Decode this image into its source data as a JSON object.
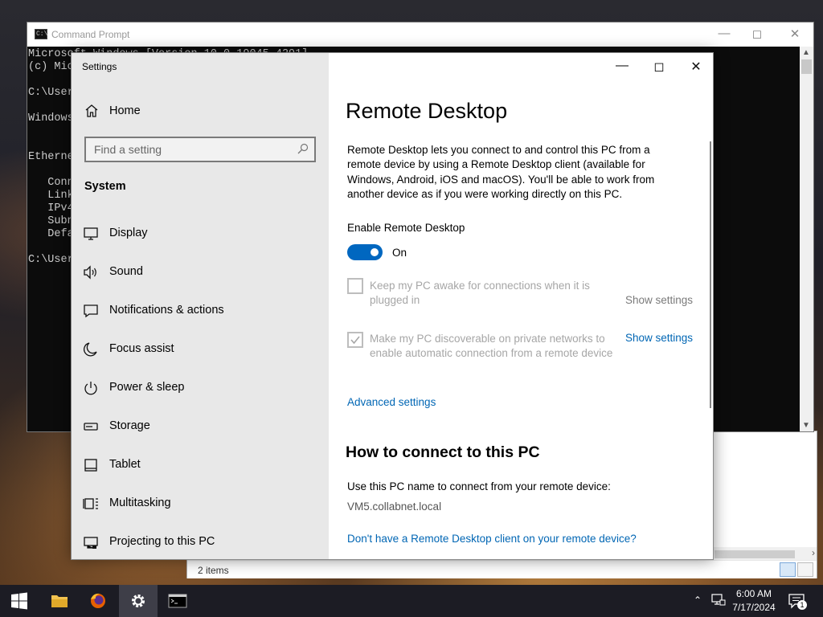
{
  "cmd": {
    "title": "Command Prompt",
    "lines": "Microsoft Windows [Version 10.0.19045.4291]\n(c) Microsoft Corporation. All rights reserved.\n\nC:\\Users\n\nWindows\n\n\nEthernet\n\n   Conn\n   Link\n   IPv4\n   Subn\n   Defa\n\nC:\\Users"
  },
  "explorer": {
    "status_items": "2 items"
  },
  "settings": {
    "window_title": "Settings",
    "sidebar": {
      "home": "Home",
      "search_placeholder": "Find a setting",
      "section": "System",
      "items": [
        {
          "label": "Display",
          "icon": "monitor-icon"
        },
        {
          "label": "Sound",
          "icon": "speaker-icon"
        },
        {
          "label": "Notifications & actions",
          "icon": "notification-icon"
        },
        {
          "label": "Focus assist",
          "icon": "moon-icon"
        },
        {
          "label": "Power & sleep",
          "icon": "power-icon"
        },
        {
          "label": "Storage",
          "icon": "storage-icon"
        },
        {
          "label": "Tablet",
          "icon": "tablet-icon"
        },
        {
          "label": "Multitasking",
          "icon": "multitasking-icon"
        },
        {
          "label": "Projecting to this PC",
          "icon": "projecting-icon"
        }
      ]
    },
    "content": {
      "title": "Remote Desktop",
      "description": "Remote Desktop lets you connect to and control this PC from a remote device by using a Remote Desktop client (available for Windows, Android, iOS and macOS). You'll be able to work from another device as if you were working directly on this PC.",
      "enable_label": "Enable Remote Desktop",
      "toggle_state": "On",
      "toggle_on": true,
      "option1": {
        "label": "Keep my PC awake for connections when it is plugged in",
        "checked": false,
        "link": "Show settings"
      },
      "option2": {
        "label": "Make my PC discoverable on private networks to enable automatic connection from a remote device",
        "checked": true,
        "link": "Show settings"
      },
      "advanced_link": "Advanced settings",
      "how_title": "How to connect to this PC",
      "use_name": "Use this PC name to connect from your remote device:",
      "pc_name": "VM5.collabnet.local",
      "client_link": "Don't have a Remote Desktop client on your remote device?"
    }
  },
  "taskbar": {
    "time": "6:00 AM",
    "date": "7/17/2024",
    "notification_count": "1"
  },
  "colors": {
    "accent": "#0067c0",
    "link": "#0066b4",
    "sidebar_bg": "#e8e8e8",
    "disabled_text": "#a6a6a6"
  }
}
